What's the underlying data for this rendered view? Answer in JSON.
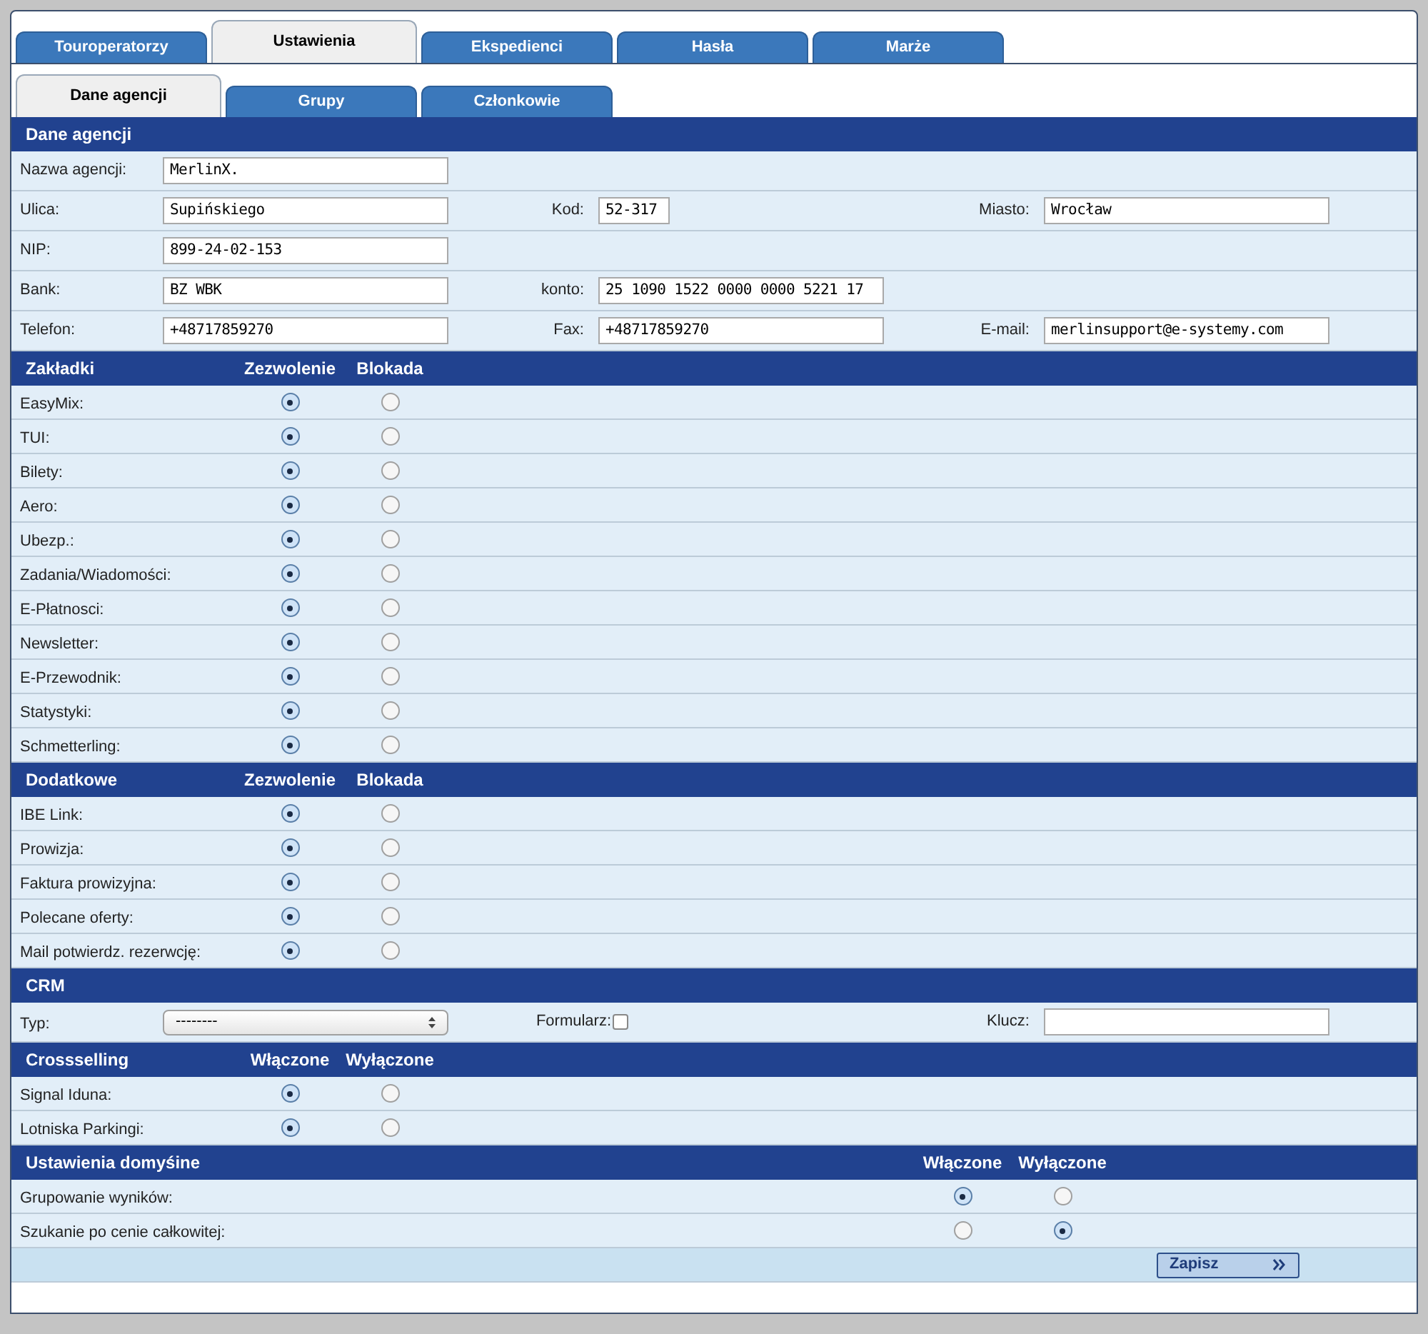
{
  "tabs": [
    {
      "label": "Touroperatorzy",
      "selected": false
    },
    {
      "label": "Ustawienia",
      "selected": true
    },
    {
      "label": "Ekspedienci",
      "selected": false
    },
    {
      "label": "Hasła",
      "selected": false
    },
    {
      "label": "Marże",
      "selected": false
    }
  ],
  "subtabs": [
    {
      "label": "Dane agencji",
      "selected": true
    },
    {
      "label": "Grupy",
      "selected": false
    },
    {
      "label": "Członkowie",
      "selected": false
    }
  ],
  "sections": [
    {
      "kind": "fields",
      "title": "Dane agencji",
      "rows": [
        {
          "left": {
            "label": "Nazwa agencji:",
            "value": "MerlinX."
          }
        },
        {
          "left": {
            "label": "Ulica:",
            "value": "Supińskiego"
          },
          "middle": {
            "label": "Kod:",
            "value": "52-317",
            "short": true
          },
          "right": {
            "label": "Miasto:",
            "value": "Wrocław"
          }
        },
        {
          "left": {
            "label": "NIP:",
            "value": "899-24-02-153"
          }
        },
        {
          "left": {
            "label": "Bank:",
            "value": "BZ WBK"
          },
          "middle": {
            "label": "konto:",
            "value": "25 1090 1522 0000 0000 5221 17"
          }
        },
        {
          "left": {
            "label": "Telefon:",
            "value": "+48717859270"
          },
          "middle": {
            "label": "Fax:",
            "value": "+48717859270"
          },
          "right": {
            "label": "E-mail:",
            "value": "merlinsupport@e-systemy.com"
          }
        }
      ]
    },
    {
      "kind": "choices",
      "title": "Zakładki",
      "columns": [
        "Zezwolenie",
        "Blokada"
      ],
      "rows": [
        {
          "label": "EasyMix:",
          "options": [
            {
              "selected": true
            },
            {
              "selected": false
            }
          ]
        },
        {
          "label": "TUI:",
          "options": [
            {
              "selected": true
            },
            {
              "selected": false
            }
          ]
        },
        {
          "label": "Bilety:",
          "options": [
            {
              "selected": true
            },
            {
              "selected": false
            }
          ]
        },
        {
          "label": "Aero:",
          "options": [
            {
              "selected": true
            },
            {
              "selected": false
            }
          ]
        },
        {
          "label": "Ubezp.:",
          "options": [
            {
              "selected": true
            },
            {
              "selected": false
            }
          ]
        },
        {
          "label": "Zadania/Wiadomości:",
          "options": [
            {
              "selected": true
            },
            {
              "selected": false
            }
          ]
        },
        {
          "label": "E-Płatnosci:",
          "options": [
            {
              "selected": true
            },
            {
              "selected": false
            }
          ]
        },
        {
          "label": "Newsletter:",
          "options": [
            {
              "selected": true
            },
            {
              "selected": false
            }
          ]
        },
        {
          "label": "E-Przewodnik:",
          "options": [
            {
              "selected": true
            },
            {
              "selected": false
            }
          ]
        },
        {
          "label": "Statystyki:",
          "options": [
            {
              "selected": true
            },
            {
              "selected": false
            }
          ]
        },
        {
          "label": "Schmetterling:",
          "options": [
            {
              "selected": true
            },
            {
              "selected": false
            }
          ]
        }
      ]
    },
    {
      "kind": "choices",
      "title": "Dodatkowe",
      "columns": [
        "Zezwolenie",
        "Blokada"
      ],
      "rows": [
        {
          "label": "IBE Link:",
          "options": [
            {
              "selected": true
            },
            {
              "selected": false
            }
          ]
        },
        {
          "label": "Prowizja:",
          "options": [
            {
              "selected": true
            },
            {
              "selected": false
            }
          ]
        },
        {
          "label": "Faktura prowizyjna:",
          "options": [
            {
              "selected": true
            },
            {
              "selected": false
            }
          ]
        },
        {
          "label": "Polecane oferty:",
          "options": [
            {
              "selected": true
            },
            {
              "selected": false
            }
          ]
        },
        {
          "label": "Mail potwierdz. rezerwcję:",
          "options": [
            {
              "selected": true
            },
            {
              "selected": false
            }
          ]
        }
      ]
    },
    {
      "kind": "crm",
      "title": "CRM",
      "type_label": "Typ:",
      "type_value": "--------",
      "form_label": "Formularz:",
      "form_checked": false,
      "key_label": "Klucz:"
    },
    {
      "kind": "choices",
      "title": "Crossselling",
      "columns": [
        "Włączone",
        "Wyłączone"
      ],
      "rows": [
        {
          "label": "Signal Iduna:",
          "options": [
            {
              "selected": true
            },
            {
              "selected": false
            }
          ]
        },
        {
          "label": "Lotniska Parkingi:",
          "options": [
            {
              "selected": true
            },
            {
              "selected": false
            }
          ]
        }
      ]
    },
    {
      "kind": "choices_right",
      "title": "Ustawienia domyśine",
      "columns": [
        "Włączone",
        "Wyłączone"
      ],
      "rows": [
        {
          "label": "Grupowanie wyników:",
          "options": [
            {
              "selected": true
            },
            {
              "selected": false
            }
          ]
        },
        {
          "label": "Szukanie po cenie całkowitej:",
          "options": [
            {
              "selected": false
            },
            {
              "selected": true
            }
          ]
        }
      ]
    }
  ],
  "save_button": "Zapisz"
}
